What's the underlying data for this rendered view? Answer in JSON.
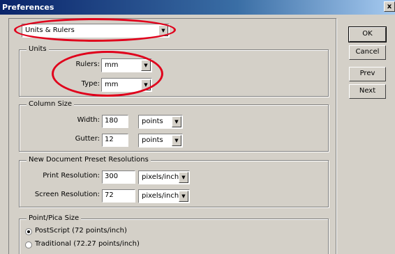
{
  "window": {
    "title": "Preferences",
    "close_glyph": "x"
  },
  "section_select": {
    "value": "Units & Rulers",
    "arrow_icon": "chevron-down-icon"
  },
  "units": {
    "legend": "Units",
    "rulers": {
      "label": "Rulers:",
      "value": "mm"
    },
    "type": {
      "label": "Type:",
      "value": "mm"
    }
  },
  "column_size": {
    "legend": "Column Size",
    "width": {
      "label": "Width:",
      "value": "180",
      "unit": "points"
    },
    "gutter": {
      "label": "Gutter:",
      "value": "12",
      "unit": "points"
    }
  },
  "preset_res": {
    "legend": "New Document Preset Resolutions",
    "print": {
      "label": "Print Resolution:",
      "value": "300",
      "unit": "pixels/inch"
    },
    "screen": {
      "label": "Screen Resolution:",
      "value": "72",
      "unit": "pixels/inch"
    }
  },
  "point_pica": {
    "legend": "Point/Pica Size",
    "options": [
      {
        "label": "PostScript (72 points/inch)",
        "selected": true
      },
      {
        "label": "Traditional (72.27 points/inch)",
        "selected": false
      }
    ]
  },
  "buttons": {
    "ok": "OK",
    "cancel": "Cancel",
    "prev": "Prev",
    "next": "Next"
  },
  "annotation_color": "#e0001b"
}
